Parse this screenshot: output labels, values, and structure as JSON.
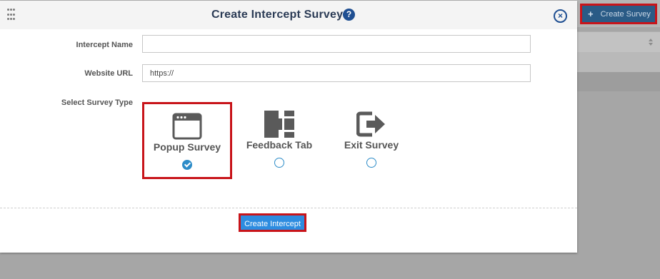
{
  "background": {
    "create_survey_label": "Create Survey",
    "create_survey_icon": "plus-icon"
  },
  "modal": {
    "title": "Create Intercept Survey",
    "help_icon": "?",
    "close_icon": "×",
    "intercept_name_label": "Intercept Name",
    "intercept_name_value": "",
    "website_url_label": "Website URL",
    "website_url_value": "https://",
    "survey_type_label": "Select Survey Type",
    "survey_types": [
      {
        "label": "Popup Survey",
        "icon": "popup-window-icon",
        "selected": true
      },
      {
        "label": "Feedback Tab",
        "icon": "feedback-tab-icon",
        "selected": false
      },
      {
        "label": "Exit Survey",
        "icon": "exit-icon",
        "selected": false
      }
    ],
    "create_button_label": "Create Intercept"
  },
  "colors": {
    "accent": "#2d8ce0",
    "title": "#2b3b55",
    "highlight": "#c8141a",
    "icon_gray": "#5a5a5a"
  }
}
